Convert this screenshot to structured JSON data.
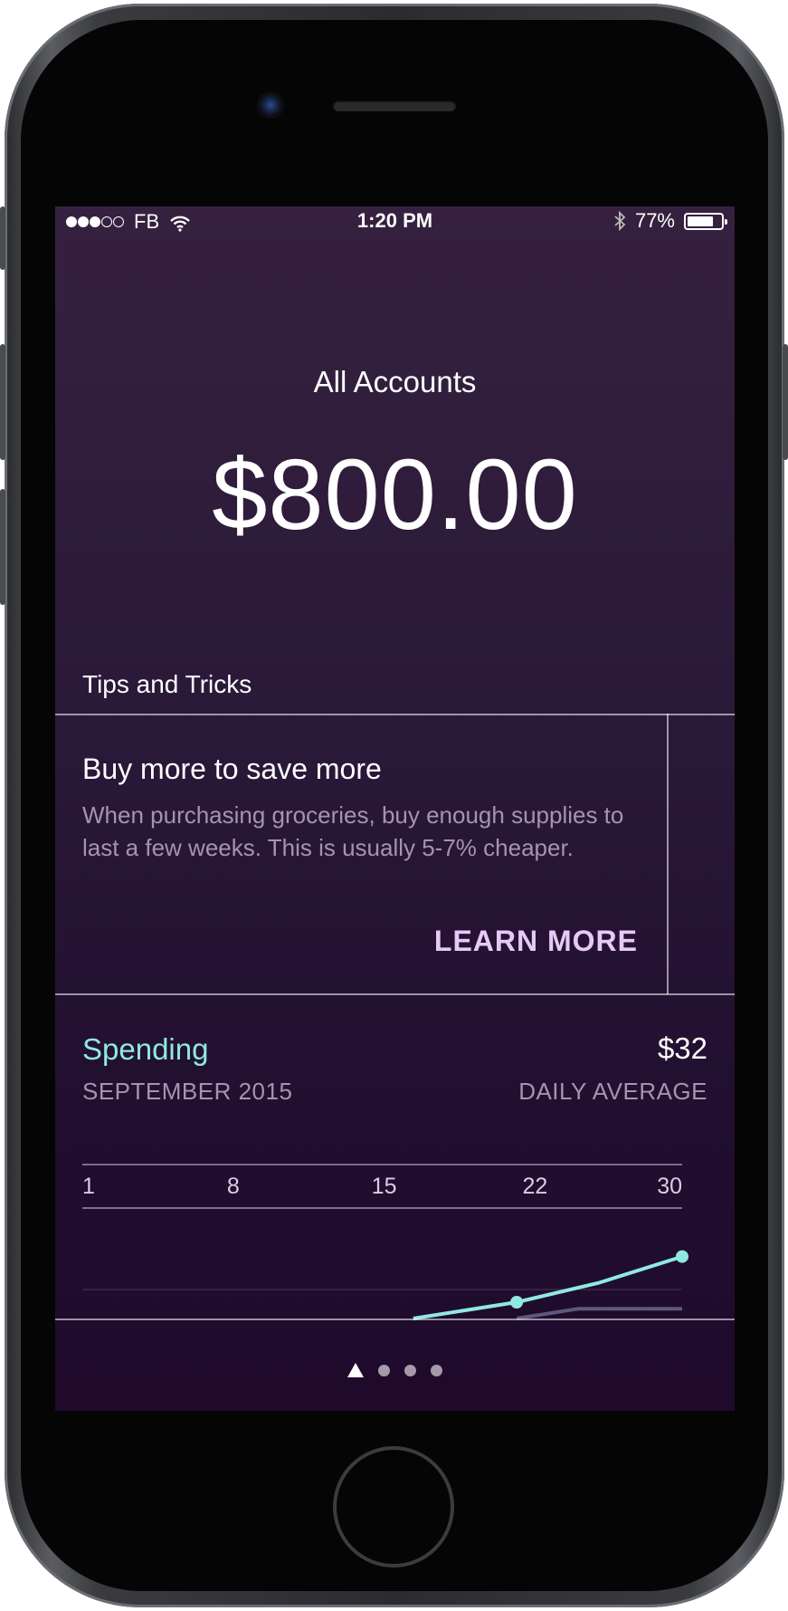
{
  "status_bar": {
    "carrier": "FB",
    "time": "1:20 PM",
    "battery": "77%",
    "battery_level": 0.77,
    "signal_bars_filled": 3,
    "signal_bars_total": 5
  },
  "accounts": {
    "title": "All Accounts",
    "balance": "$800.00"
  },
  "tips": {
    "section_title": "Tips and Tricks",
    "card_title": "Buy more to save more",
    "card_body": "When purchasing groceries, buy enough supplies to last a few weeks. This is usually 5-7% cheaper.",
    "action_label": "LEARN MORE"
  },
  "spending": {
    "title": "Spending",
    "value": "$32",
    "period": "SEPTEMBER 2015",
    "value_caption": "DAILY AVERAGE"
  },
  "chart_data": {
    "type": "line",
    "x_ticks": [
      "1",
      "8",
      "15",
      "22",
      "30"
    ],
    "xlim": [
      1,
      30
    ],
    "series": [
      {
        "color": "#8fe9e1",
        "points": [
          [
            17,
            0.0
          ],
          [
            22,
            0.15
          ],
          [
            26,
            0.33
          ],
          [
            30,
            0.57
          ]
        ],
        "markers": [
          22,
          30
        ]
      },
      {
        "color": "#5f587a",
        "points": [
          [
            22,
            0.0
          ],
          [
            25,
            0.09
          ],
          [
            30,
            0.09
          ]
        ]
      }
    ]
  },
  "pager": {
    "total_pages": 4,
    "current_page": 1
  },
  "colors": {
    "accent": "#8fe9e1",
    "action": "#e7c9f7",
    "secondary_text": "#a594ad",
    "background_top": "#35213f",
    "background_bottom": "#1f0a2c"
  }
}
